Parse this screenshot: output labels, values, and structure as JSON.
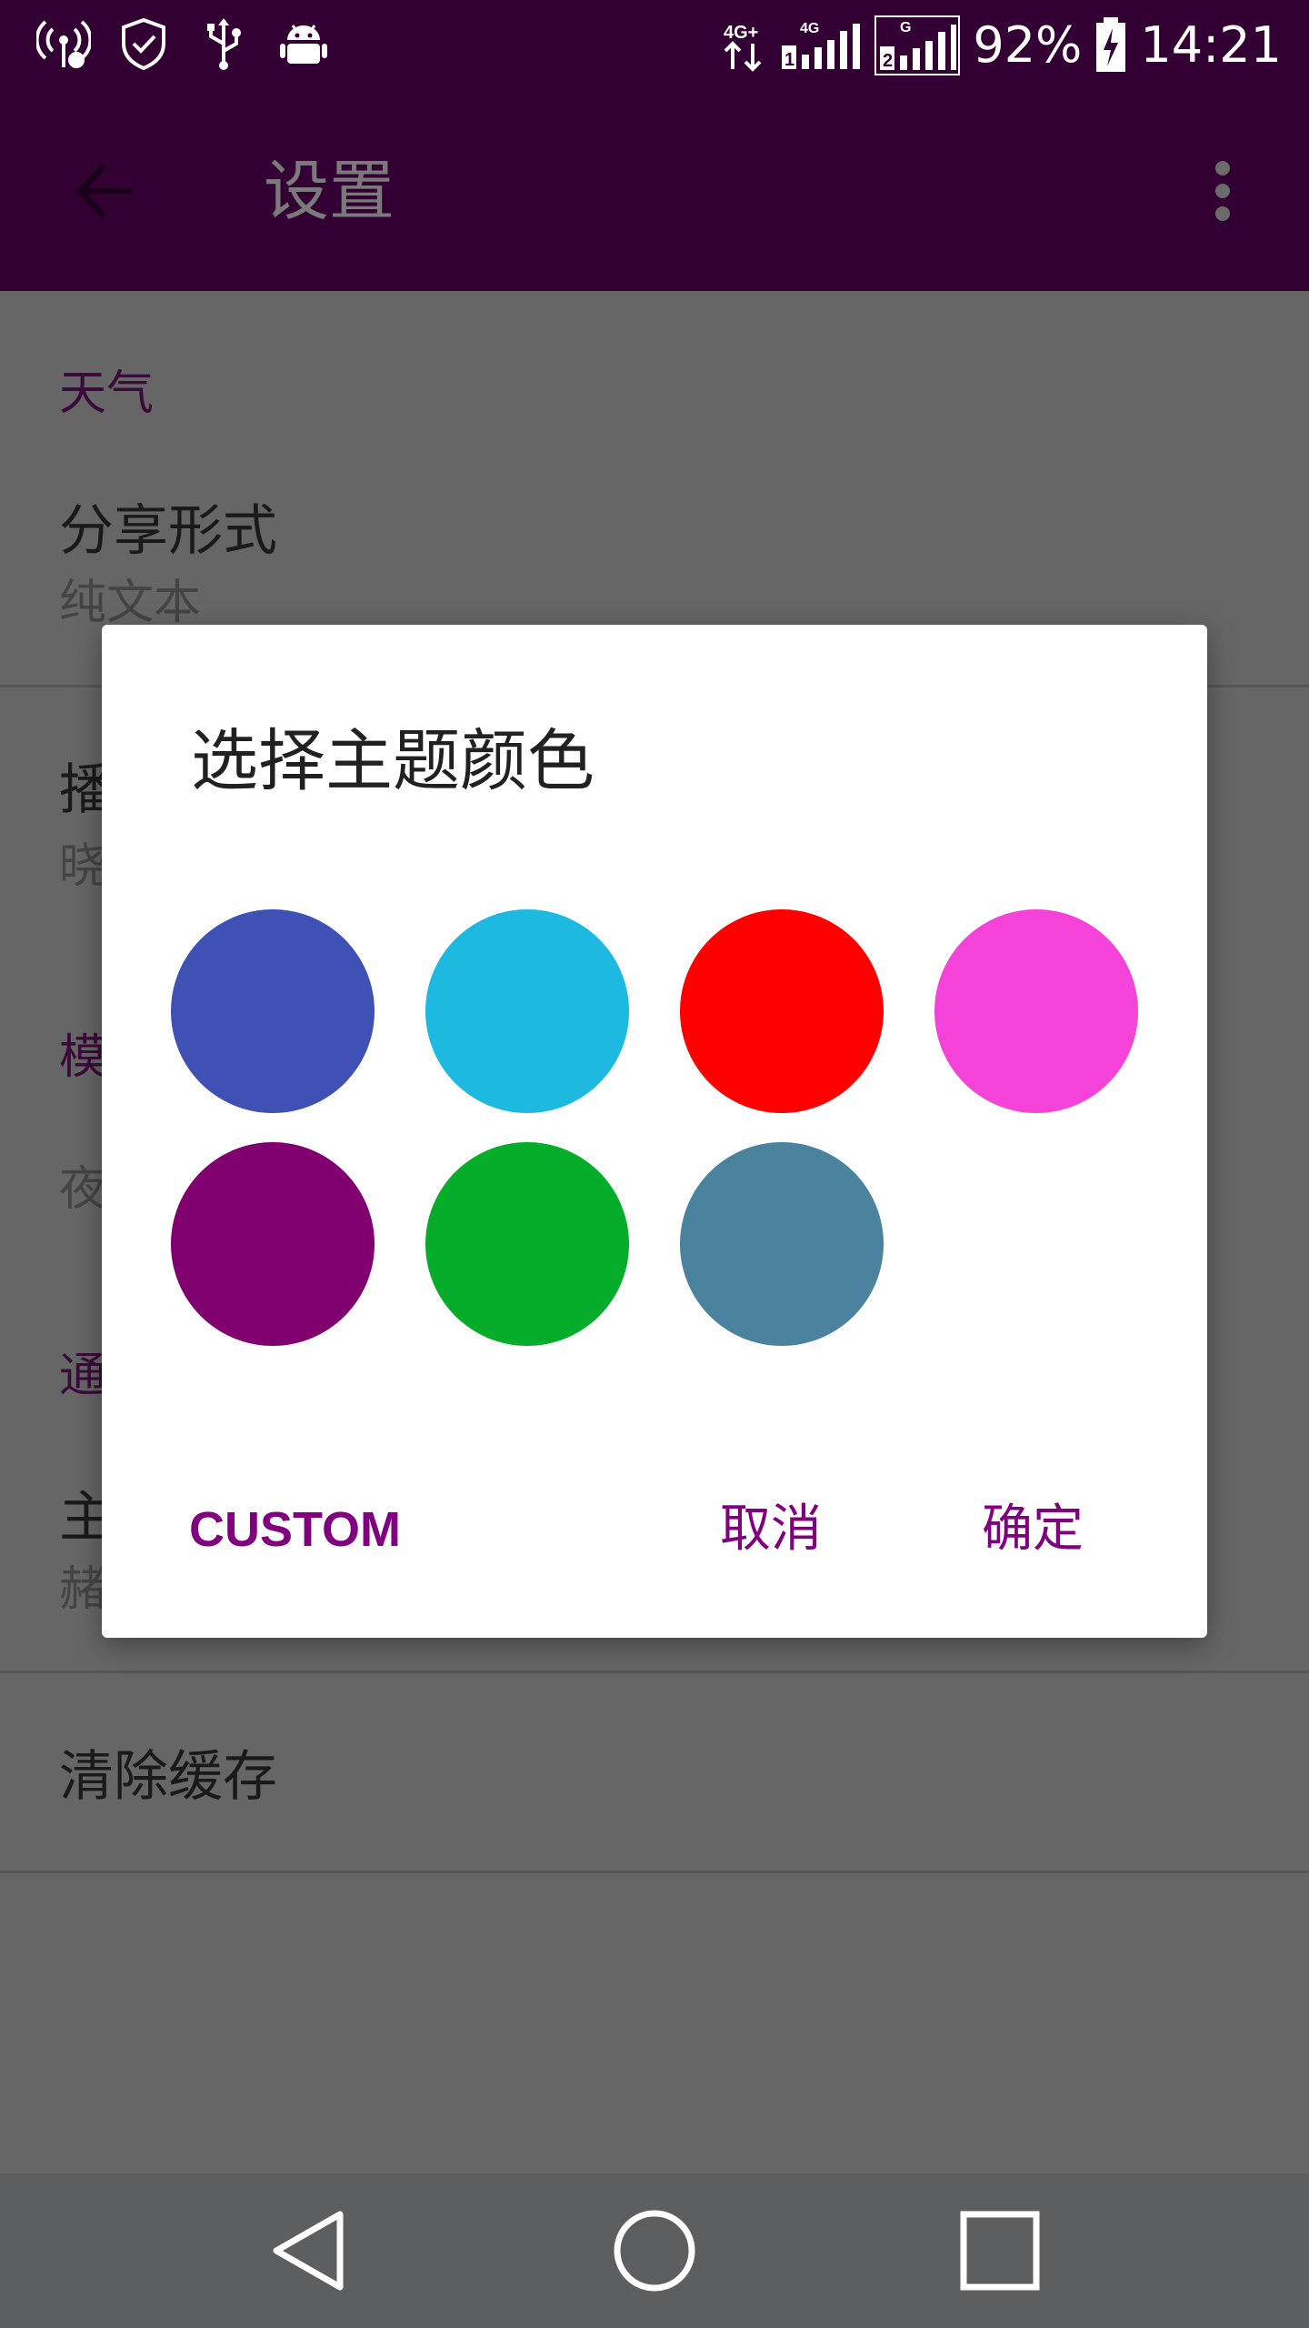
{
  "status_bar": {
    "battery_percent": "92%",
    "time": "14:21",
    "network_labels": [
      "4G+",
      "4G",
      "G"
    ],
    "sim_labels": [
      "1",
      "2"
    ],
    "left_icons": [
      "hotspot-icon",
      "shield-check-icon",
      "usb-icon",
      "android-debug-icon"
    ],
    "background": "#330033"
  },
  "app_bar": {
    "title": "设置",
    "back_icon": "arrow-left-icon",
    "menu_icon": "more-vert-icon"
  },
  "settings": {
    "sections": [
      {
        "header": "天气",
        "items": [
          {
            "title": "分享形式",
            "subtitle": "纯文本"
          },
          {
            "title": "播",
            "subtitle": "晓"
          }
        ]
      },
      {
        "header": "模",
        "items": [
          {
            "title": "",
            "subtitle": "夜"
          }
        ]
      },
      {
        "header": "通",
        "items": [
          {
            "title": "主",
            "subtitle": "赭"
          },
          {
            "title": "清除缓存",
            "subtitle": ""
          }
        ]
      }
    ]
  },
  "dialog": {
    "title": "选择主题颜色",
    "swatches": [
      {
        "name": "indigo",
        "color": "#3f51b5"
      },
      {
        "name": "light-blue",
        "color": "#1eb9e0"
      },
      {
        "name": "red",
        "color": "#ff0000"
      },
      {
        "name": "pink",
        "color": "#f542d8"
      },
      {
        "name": "purple",
        "color": "#800070"
      },
      {
        "name": "green",
        "color": "#06ad2b"
      },
      {
        "name": "blue-grey",
        "color": "#4b839f"
      }
    ],
    "custom_label": "CUSTOM",
    "cancel_label": "取消",
    "ok_label": "确定",
    "accent": "#800080"
  },
  "nav_bar": {
    "buttons": [
      "back-triangle-icon",
      "home-circle-icon",
      "recents-square-icon"
    ],
    "background": "#5c5e60"
  }
}
